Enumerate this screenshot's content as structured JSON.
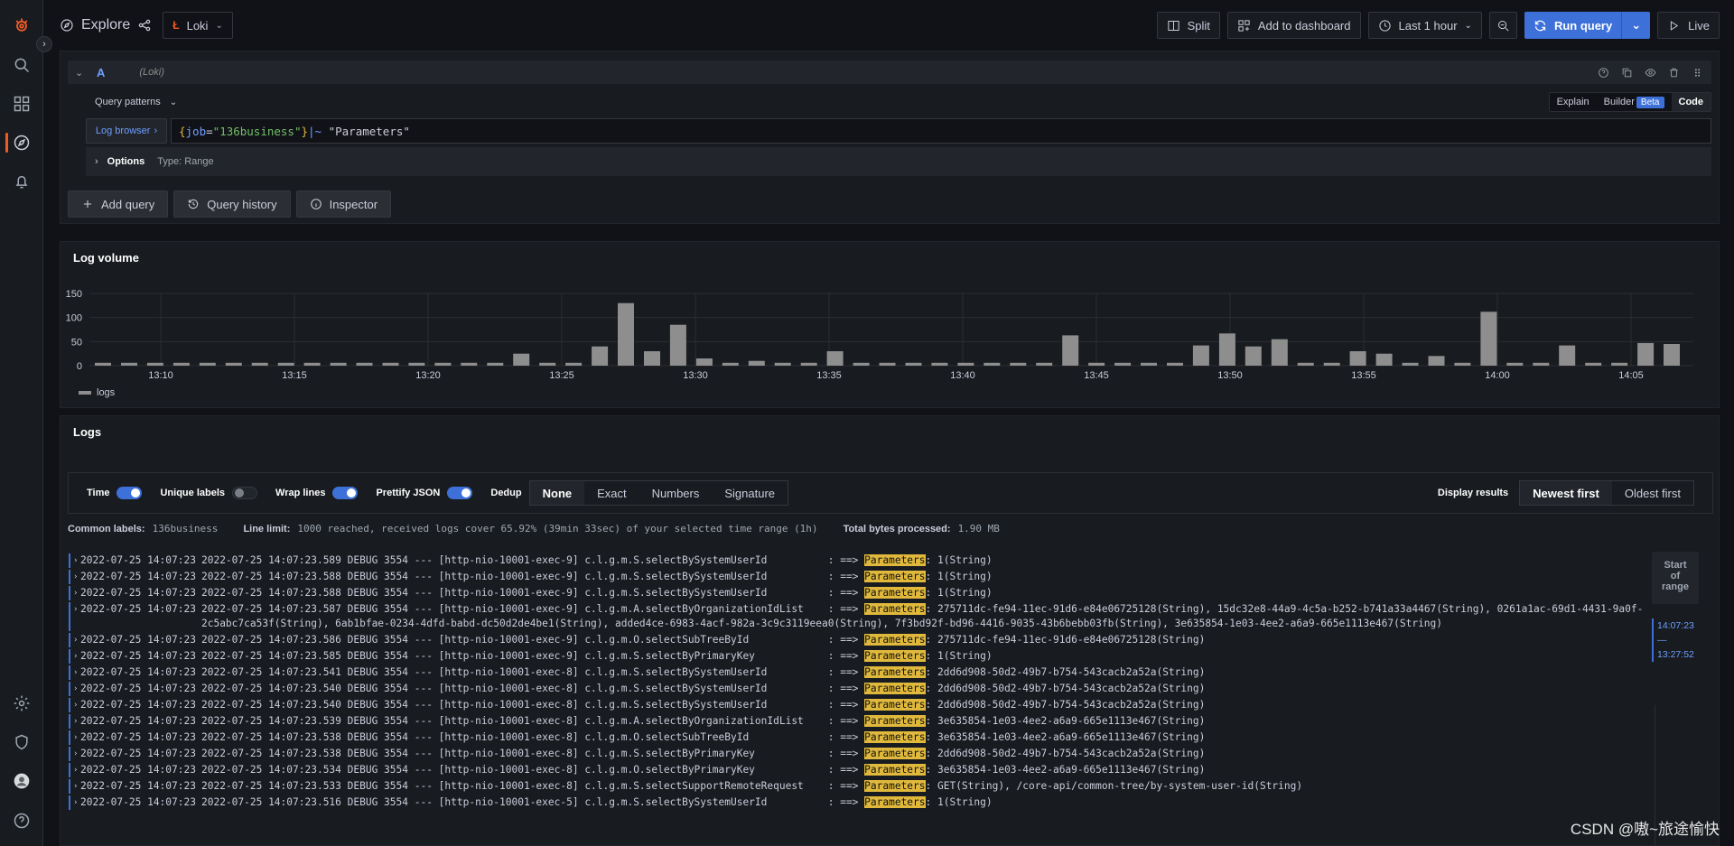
{
  "app": {
    "title": "Explore"
  },
  "datasource": {
    "name": "Loki"
  },
  "toolbar": {
    "split": "Split",
    "add_to_dashboard": "Add to dashboard",
    "time_range": "Last 1 hour",
    "run_query": "Run query",
    "live": "Live"
  },
  "query": {
    "ref_id": "A",
    "datasource_label": "(Loki)",
    "patterns_label": "Query patterns",
    "modes": {
      "explain": "Explain",
      "builder": "Builder",
      "beta": "Beta",
      "code": "Code"
    },
    "log_browser": "Log browser",
    "expr": {
      "brace_open": "{",
      "key": "job",
      "eq": "=",
      "value": "\"136business\"",
      "brace_close": "}",
      "op": "|~ ",
      "pattern": "\"Parameters\""
    },
    "options_label": "Options",
    "options_type": "Type: Range",
    "buttons": {
      "add_query": "Add query",
      "history": "Query history",
      "inspector": "Inspector"
    }
  },
  "log_volume": {
    "title": "Log volume",
    "legend": "logs"
  },
  "chart_data": {
    "type": "bar",
    "ylim": [
      0,
      150
    ],
    "yticks": [
      0,
      50,
      100,
      150
    ],
    "xticks": [
      "13:10",
      "13:15",
      "13:20",
      "13:25",
      "13:30",
      "13:35",
      "13:40",
      "13:45",
      "13:50",
      "13:55",
      "14:00",
      "14:05"
    ],
    "series": [
      {
        "name": "logs",
        "color": "#8e8e8e",
        "values": [
          6,
          6,
          6,
          6,
          6,
          6,
          6,
          6,
          6,
          6,
          6,
          6,
          6,
          6,
          6,
          6,
          25,
          6,
          6,
          40,
          130,
          30,
          85,
          15,
          6,
          10,
          6,
          6,
          30,
          6,
          6,
          6,
          6,
          6,
          6,
          6,
          6,
          63,
          6,
          6,
          6,
          6,
          42,
          67,
          40,
          55,
          6,
          6,
          30,
          25,
          6,
          20,
          6,
          112,
          6,
          6,
          42,
          6,
          6,
          47,
          45
        ]
      }
    ]
  },
  "logs": {
    "title": "Logs",
    "controls": {
      "time": "Time",
      "unique_labels": "Unique labels",
      "wrap_lines": "Wrap lines",
      "prettify_json": "Prettify JSON",
      "dedup": "Dedup",
      "dedup_options": [
        "None",
        "Exact",
        "Numbers",
        "Signature"
      ],
      "display_results": "Display results",
      "newest_first": "Newest first",
      "oldest_first": "Oldest first"
    },
    "common_labels_label": "Common labels:",
    "common_labels_value": "136business",
    "line_limit_label": "Line limit:",
    "line_limit_value": "1000 reached, received logs cover 65.92% (39min 33sec) of your selected time range (1h)",
    "bytes_label": "Total bytes processed:",
    "bytes_value": "1.90 MB",
    "range": {
      "start_line1": "Start",
      "start_line2": "of",
      "start_line3": "range",
      "from": "14:07:23",
      "dash": "—",
      "to": "13:27:52"
    },
    "highlight": "Parameters",
    "lines": [
      {
        "ts": "2022-07-25 14:07:23",
        "pre": "2022-07-25 14:07:23.589 DEBUG 3554 --- [http-nio-10001-exec-9] c.l.g.m.S.selectBySystemUserId          : ==> ",
        "post": ": 1(String)"
      },
      {
        "ts": "2022-07-25 14:07:23",
        "pre": "2022-07-25 14:07:23.588 DEBUG 3554 --- [http-nio-10001-exec-9] c.l.g.m.S.selectBySystemUserId          : ==> ",
        "post": ": 1(String)"
      },
      {
        "ts": "2022-07-25 14:07:23",
        "pre": "2022-07-25 14:07:23.588 DEBUG 3554 --- [http-nio-10001-exec-9] c.l.g.m.S.selectBySystemUserId          : ==> ",
        "post": ": 1(String)"
      },
      {
        "ts": "2022-07-25 14:07:23",
        "pre": "2022-07-25 14:07:23.587 DEBUG 3554 --- [http-nio-10001-exec-9] c.l.g.m.A.selectByOrganizationIdList    : ==> ",
        "post": ": 275711dc-fe94-11ec-91d6-e84e06725128(String), 15dc32e8-44a9-4c5a-b252-b741a33a4467(String), 0261a1ac-69d1-4431-9a0f-2c5abc7ca53f(String), 6ab1bfae-0234-4dfd-babd-dc50d2de4be1(String), added4ce-6983-4acf-982a-3c9c3119eea0(String), 7f3bd92f-bd96-4416-9035-43b6bebb03fb(String), 3e635854-1e03-4ee2-a6a9-665e1113e467(String)"
      },
      {
        "ts": "2022-07-25 14:07:23",
        "pre": "2022-07-25 14:07:23.586 DEBUG 3554 --- [http-nio-10001-exec-9] c.l.g.m.O.selectSubTreeById             : ==> ",
        "post": ": 275711dc-fe94-11ec-91d6-e84e06725128(String)"
      },
      {
        "ts": "2022-07-25 14:07:23",
        "pre": "2022-07-25 14:07:23.585 DEBUG 3554 --- [http-nio-10001-exec-9] c.l.g.m.S.selectByPrimaryKey            : ==> ",
        "post": ": 1(String)"
      },
      {
        "ts": "2022-07-25 14:07:23",
        "pre": "2022-07-25 14:07:23.541 DEBUG 3554 --- [http-nio-10001-exec-8] c.l.g.m.S.selectBySystemUserId          : ==> ",
        "post": ": 2dd6d908-50d2-49b7-b754-543cacb2a52a(String)"
      },
      {
        "ts": "2022-07-25 14:07:23",
        "pre": "2022-07-25 14:07:23.540 DEBUG 3554 --- [http-nio-10001-exec-8] c.l.g.m.S.selectBySystemUserId          : ==> ",
        "post": ": 2dd6d908-50d2-49b7-b754-543cacb2a52a(String)"
      },
      {
        "ts": "2022-07-25 14:07:23",
        "pre": "2022-07-25 14:07:23.540 DEBUG 3554 --- [http-nio-10001-exec-8] c.l.g.m.S.selectBySystemUserId          : ==> ",
        "post": ": 2dd6d908-50d2-49b7-b754-543cacb2a52a(String)"
      },
      {
        "ts": "2022-07-25 14:07:23",
        "pre": "2022-07-25 14:07:23.539 DEBUG 3554 --- [http-nio-10001-exec-8] c.l.g.m.A.selectByOrganizationIdList    : ==> ",
        "post": ": 3e635854-1e03-4ee2-a6a9-665e1113e467(String)"
      },
      {
        "ts": "2022-07-25 14:07:23",
        "pre": "2022-07-25 14:07:23.538 DEBUG 3554 --- [http-nio-10001-exec-8] c.l.g.m.O.selectSubTreeById             : ==> ",
        "post": ": 3e635854-1e03-4ee2-a6a9-665e1113e467(String)"
      },
      {
        "ts": "2022-07-25 14:07:23",
        "pre": "2022-07-25 14:07:23.538 DEBUG 3554 --- [http-nio-10001-exec-8] c.l.g.m.S.selectByPrimaryKey            : ==> ",
        "post": ": 2dd6d908-50d2-49b7-b754-543cacb2a52a(String)"
      },
      {
        "ts": "2022-07-25 14:07:23",
        "pre": "2022-07-25 14:07:23.534 DEBUG 3554 --- [http-nio-10001-exec-8] c.l.g.m.O.selectByPrimaryKey            : ==> ",
        "post": ": 3e635854-1e03-4ee2-a6a9-665e1113e467(String)"
      },
      {
        "ts": "2022-07-25 14:07:23",
        "pre": "2022-07-25 14:07:23.533 DEBUG 3554 --- [http-nio-10001-exec-8] c.l.g.m.S.selectSupportRemoteRequest    : ==> ",
        "post": ": GET(String), /core-api/common-tree/by-system-user-id(String)"
      },
      {
        "ts": "2022-07-25 14:07:23",
        "pre": "2022-07-25 14:07:23.516 DEBUG 3554 --- [http-nio-10001-exec-5] c.l.g.m.S.selectBySystemUserId          : ==> ",
        "post": ": 1(String)"
      }
    ]
  },
  "watermark": "CSDN @嗷~旅途愉快"
}
